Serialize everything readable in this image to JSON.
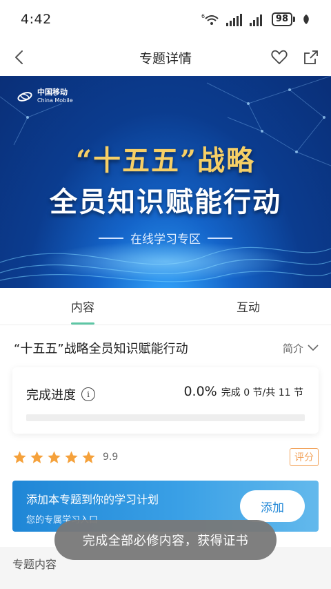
{
  "status_bar": {
    "time": "4:42",
    "network_label": "6",
    "battery": "98"
  },
  "header": {
    "title": "专题详情"
  },
  "banner": {
    "logo_cn": "中国移动",
    "logo_en": "China Mobile",
    "title_line1": "“十五五”战略",
    "title_line2": "全员知识赋能行动",
    "subtitle": "在线学习专区"
  },
  "tabs": [
    {
      "label": "内容",
      "active": true
    },
    {
      "label": "互动",
      "active": false
    }
  ],
  "topic": {
    "title": "“十五五”战略全员知识赋能行动",
    "intro_label": "简介"
  },
  "progress": {
    "label": "完成进度",
    "percent": "0.0%",
    "detail": "完成 0 节/共 11 节",
    "fraction": 0
  },
  "rating": {
    "stars": 5,
    "score": "9.9",
    "rate_label": "评分"
  },
  "plan": {
    "title": "添加本专题到你的学习计划",
    "subtitle": "您的专属学习入口",
    "add_label": "添加"
  },
  "toast": {
    "text": "完成全部必修内容，获得证书"
  },
  "section": {
    "title": "专题内容"
  },
  "colors": {
    "accent": "#5ec6a5",
    "star": "#f5a13b",
    "plan_blue": "#1f86d6"
  }
}
